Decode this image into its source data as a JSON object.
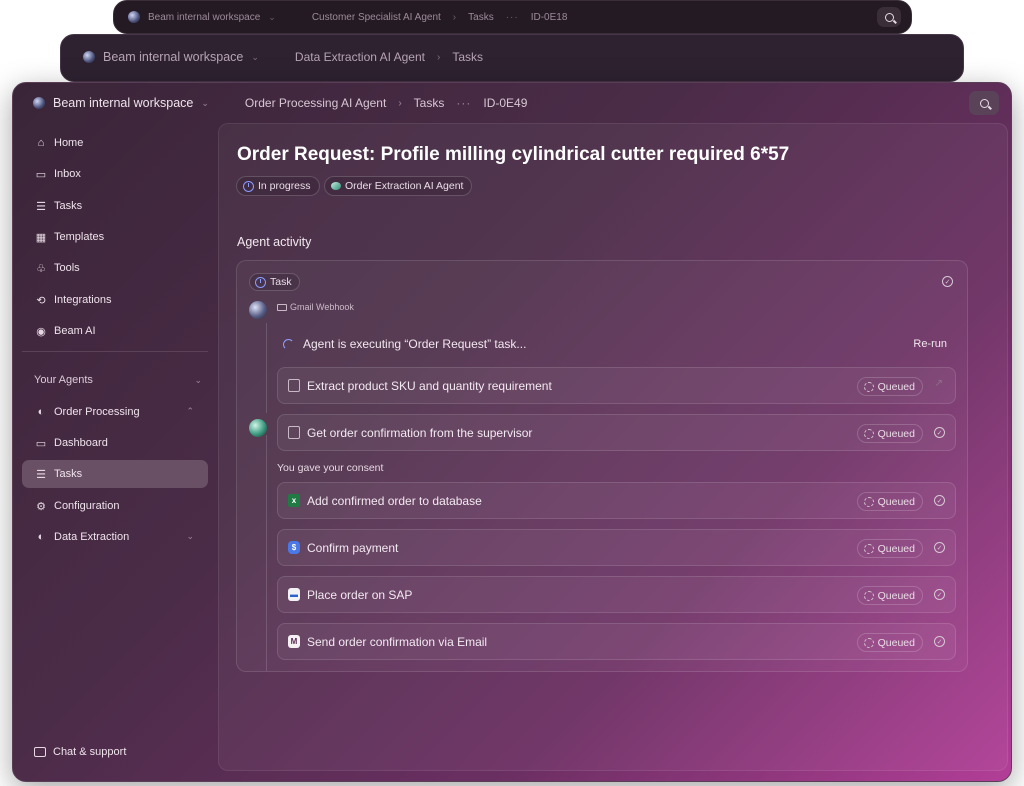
{
  "back_window_2": {
    "workspace": "Beam internal workspace",
    "crumbs": [
      "Customer Specialist AI Agent",
      "Tasks",
      "ID-0E18"
    ]
  },
  "back_window_1": {
    "workspace": "Beam internal workspace",
    "crumbs": [
      "Data Extraction AI Agent",
      "Tasks"
    ]
  },
  "main_window": {
    "workspace": "Beam internal workspace",
    "breadcrumb": {
      "agent": "Order Processing AI Agent",
      "section": "Tasks",
      "more": "···",
      "id": "ID-0E49"
    }
  },
  "sidebar": {
    "items": [
      {
        "label": "Home",
        "icon": "home-icon",
        "glyph": "⌂"
      },
      {
        "label": "Inbox",
        "icon": "inbox-icon",
        "glyph": "▭"
      },
      {
        "label": "Tasks",
        "icon": "list-icon",
        "glyph": "☰"
      },
      {
        "label": "Templates",
        "icon": "grid-icon",
        "glyph": "▦"
      },
      {
        "label": "Tools",
        "icon": "tools-icon",
        "glyph": "♧"
      },
      {
        "label": "Integrations",
        "icon": "integrations-icon",
        "glyph": "⟲"
      },
      {
        "label": "Beam AI",
        "icon": "beam-ai-icon",
        "glyph": "◉"
      }
    ],
    "agents_label": "Your Agents",
    "agents": [
      {
        "label": "Order Processing",
        "glyph": "◐"
      },
      {
        "label": "Dashboard",
        "glyph": "▭"
      },
      {
        "label": "Tasks",
        "glyph": "☰"
      },
      {
        "label": "Configuration",
        "glyph": "⚙"
      },
      {
        "label": "Data Extraction",
        "glyph": "◐"
      }
    ],
    "chat_label": "Chat & support"
  },
  "task": {
    "title": "Order Request: Profile milling cylindrical cutter required 6*57",
    "status": "In progress",
    "agent": "Order Extraction AI Agent",
    "activity_label": "Agent activity",
    "task_badge": "Task",
    "trigger": "Gmail Webhook",
    "executing_text": "Agent  is executing “Order Request” task...",
    "rerun_label": "Re-run",
    "consent_text": "You gave your consent",
    "steps": [
      {
        "label": "Extract product SKU and quantity requirement",
        "status": "Queued",
        "icon": "clipboard-icon"
      },
      {
        "label": "Get order confirmation from the supervisor",
        "status": "Queued",
        "icon": "document-icon"
      },
      {
        "label": "Add confirmed order to database",
        "status": "Queued",
        "icon": "excel-icon"
      },
      {
        "label": "Confirm payment",
        "status": "Queued",
        "icon": "payment-icon"
      },
      {
        "label": "Place order on SAP",
        "status": "Queued",
        "icon": "sap-icon"
      },
      {
        "label": "Send order confirmation via Email",
        "status": "Queued",
        "icon": "gmail-icon"
      }
    ]
  }
}
